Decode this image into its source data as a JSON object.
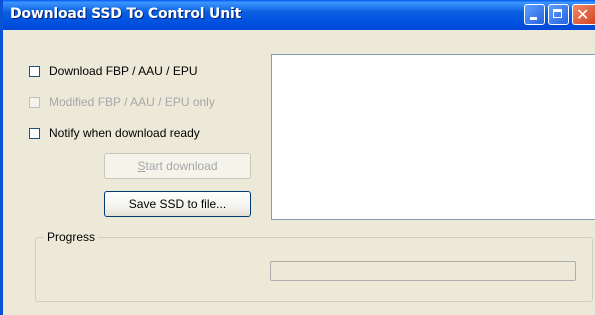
{
  "window": {
    "title": "Download SSD To Control Unit",
    "controls": {
      "minimize_icon": "minimize-icon",
      "maximize_icon": "maximize-icon",
      "close_icon": "close-icon",
      "close_glyph": "✕"
    }
  },
  "options": {
    "download_fbp": {
      "label": "Download FBP / AAU / EPU",
      "checked": false,
      "enabled": true
    },
    "modified_only": {
      "label": "Modified FBP / AAU / EPU only",
      "checked": false,
      "enabled": false
    },
    "notify_ready": {
      "label": "Notify when download ready",
      "checked": false,
      "enabled": true
    }
  },
  "buttons": {
    "start_download": {
      "label": "Start download",
      "enabled": false
    },
    "save_ssd": {
      "label": "Save SSD to file...",
      "enabled": true
    }
  },
  "output_list": {
    "items": []
  },
  "progress": {
    "group_label": "Progress",
    "value": 0
  },
  "colors": {
    "titlebar": "#0054e3",
    "window_face": "#ece9d8",
    "disabled_text": "#a7a6aa"
  }
}
